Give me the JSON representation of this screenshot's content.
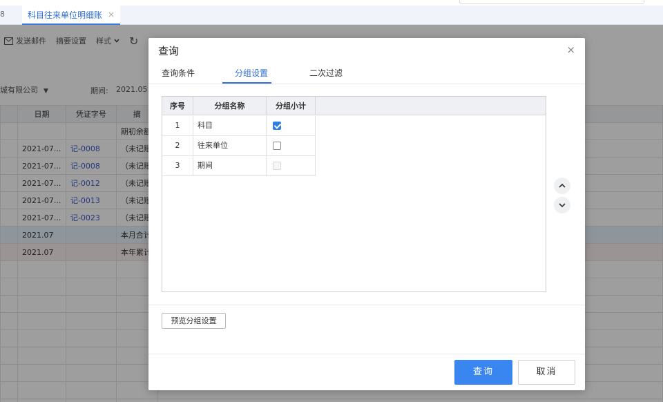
{
  "tabbar": {
    "prev_tab_label": "8",
    "active_tab_label": "科目往来单位明细账",
    "close_glyph": "×"
  },
  "toolbar": {
    "items": [
      {
        "icon": "mail-icon",
        "label": "发送邮件"
      },
      {
        "icon": "",
        "label": "摘要设置"
      },
      {
        "icon": "",
        "label": "样式"
      }
    ]
  },
  "filters": {
    "company": "城有限公司",
    "period_label": "期间:",
    "period_value": "2021.05 -"
  },
  "background_table": {
    "headers": [
      "",
      "日期",
      "凭证字号",
      "摘"
    ],
    "rows": [
      {
        "date": "",
        "voucher": "",
        "summary": "期初余额",
        "style": ""
      },
      {
        "date": "2021-07...",
        "voucher": "记-0008",
        "summary": "（未记账",
        "style": ""
      },
      {
        "date": "2021-07...",
        "voucher": "记-0008",
        "summary": "（未记账",
        "style": ""
      },
      {
        "date": "2021-07...",
        "voucher": "记-0012",
        "summary": "（未记账",
        "style": ""
      },
      {
        "date": "2021-07...",
        "voucher": "记-0013",
        "summary": "（未记账",
        "style": ""
      },
      {
        "date": "2021-07...",
        "voucher": "记-0023",
        "summary": "（未记账",
        "style": ""
      },
      {
        "date": "2021.07",
        "voucher": "",
        "summary": "本月合计",
        "style": "blue"
      },
      {
        "date": "2021.07",
        "voucher": "",
        "summary": "本年累计",
        "style": "pink"
      },
      {
        "date": "",
        "voucher": "",
        "summary": "",
        "style": ""
      },
      {
        "date": "",
        "voucher": "",
        "summary": "",
        "style": ""
      },
      {
        "date": "",
        "voucher": "",
        "summary": "",
        "style": ""
      },
      {
        "date": "",
        "voucher": "",
        "summary": "",
        "style": ""
      },
      {
        "date": "",
        "voucher": "",
        "summary": "",
        "style": ""
      },
      {
        "date": "",
        "voucher": "",
        "summary": "",
        "style": ""
      },
      {
        "date": "",
        "voucher": "",
        "summary": "",
        "style": ""
      },
      {
        "date": "",
        "voucher": "",
        "summary": "",
        "style": ""
      },
      {
        "date": "",
        "voucher": "",
        "summary": "",
        "style": ""
      }
    ]
  },
  "dialog": {
    "title": "查询",
    "close_glyph": "×",
    "tabs": [
      "查询条件",
      "分组设置",
      "二次过滤"
    ],
    "active_tab_index": 1,
    "grid": {
      "headers": [
        "序号",
        "分组名称",
        "分组小计"
      ],
      "rows": [
        {
          "index": "1",
          "name": "科目",
          "subtotal": "checked"
        },
        {
          "index": "2",
          "name": "往来单位",
          "subtotal": "unchecked"
        },
        {
          "index": "3",
          "name": "期间",
          "subtotal": "disabled"
        }
      ]
    },
    "preview_button": "预览分组设置",
    "query_button": "查询",
    "cancel_button": "取消"
  },
  "colors": {
    "accent": "#2f6fd6",
    "primary_button": "#3a86f0",
    "checkbox_checked": "#2f7ee6",
    "link": "#3a57c8"
  }
}
